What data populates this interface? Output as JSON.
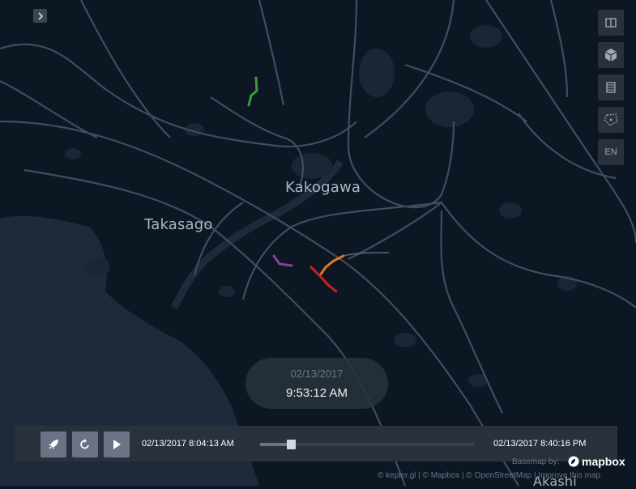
{
  "map": {
    "places": [
      "Kakogawa",
      "Takasago",
      "Akashi"
    ]
  },
  "toolbar": {
    "locale_label": "EN"
  },
  "time_display": {
    "date": "02/13/2017",
    "time": "9:53:12 AM"
  },
  "playback": {
    "start_time": "02/13/2017 8:04:13 AM",
    "end_time": "02/13/2017 8:40:16 PM",
    "progress_fraction": 0.145
  },
  "attribution": {
    "basemap_by": "Basemap by:",
    "logo_text": "mapbox",
    "credits": "© kepler.gl | © Mapbox | © OpenStreetMap | Improve this map"
  },
  "colors": {
    "background": "#0d1623",
    "land_shade": "#1a2535",
    "water": "#1e2a3a",
    "road": "#3d4e5f",
    "trip_green": "#3c9b3c",
    "trip_purple": "#8a3fa0",
    "trip_orange": "#e07b1a",
    "trip_red": "#cc2020"
  }
}
